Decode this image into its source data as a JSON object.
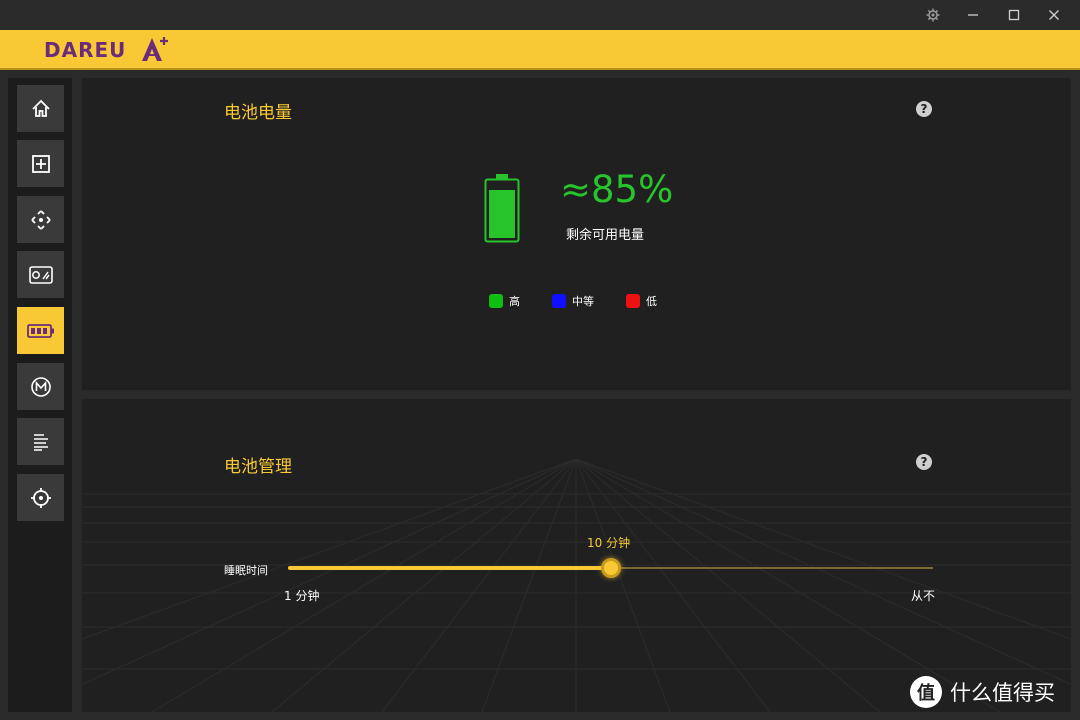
{
  "brand": {
    "logo_text": "DAREU",
    "accent_color": "#f8c935",
    "logo_color": "#6b2d7a"
  },
  "sidebar": {
    "items": [
      {
        "icon": "home-icon",
        "active": false
      },
      {
        "icon": "plus-square-icon",
        "active": false
      },
      {
        "icon": "move-arrows-icon",
        "active": false
      },
      {
        "icon": "card-toggle-icon",
        "active": false
      },
      {
        "icon": "battery-icon",
        "active": true
      },
      {
        "icon": "macro-m-icon",
        "active": false
      },
      {
        "icon": "lines-icon",
        "active": false
      },
      {
        "icon": "crosshair-icon",
        "active": false
      }
    ]
  },
  "battery_panel": {
    "title": "电池电量",
    "percent": "≈85%",
    "percent_value": 85,
    "remaining_label": "剩余可用电量",
    "battery_color": "#27c42b",
    "legend": [
      {
        "label": "高",
        "color": "#0fbf0f"
      },
      {
        "label": "中等",
        "color": "#1010ff"
      },
      {
        "label": "低",
        "color": "#ee1111"
      }
    ]
  },
  "management_panel": {
    "title": "电池管理",
    "slider": {
      "label": "睡眠时间",
      "value_text": "10 分钟",
      "fraction": 0.5,
      "min_label": "1 分钟",
      "max_label": "从不"
    }
  },
  "watermark": {
    "mark": "值",
    "text": "什么值得买"
  }
}
